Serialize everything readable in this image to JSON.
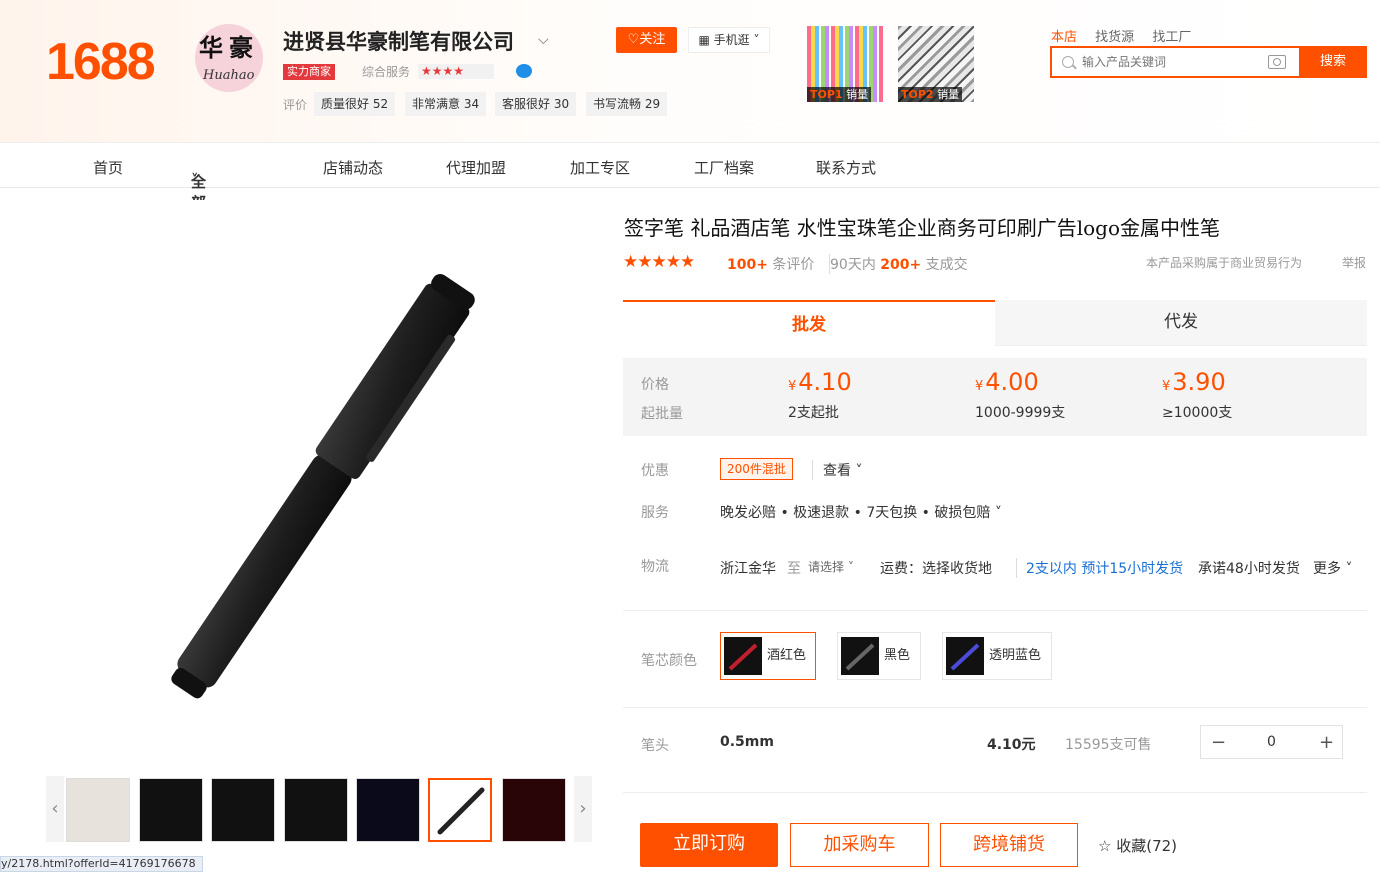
{
  "header": {
    "logo": "1688",
    "shop_name": "进贤县华豪制笔有限公司",
    "avatar_text": {
      "top_left": "华",
      "top_right": "豪",
      "script": "Huahao"
    },
    "power_badge": "实力商家",
    "service_label": "综合服务",
    "service_stars": "★★★★",
    "ratings_label": "评价",
    "ratings": [
      {
        "label": "质量很好",
        "count": "52"
      },
      {
        "label": "非常满意",
        "count": "34"
      },
      {
        "label": "客服很好",
        "count": "30"
      },
      {
        "label": "书写流畅",
        "count": "29"
      }
    ],
    "follow_button": "关注",
    "mobile_button": "手机逛",
    "top_products": [
      {
        "rank": "TOP1",
        "suffix": " 销量"
      },
      {
        "rank": "TOP2",
        "suffix": " 销量"
      }
    ],
    "search_tabs": [
      "本店",
      "找货源",
      "找工厂"
    ],
    "search_placeholder": "输入产品关键词",
    "search_button": "搜索"
  },
  "nav": {
    "items": [
      "首页",
      "全部商品",
      "店铺动态",
      "代理加盟",
      "加工专区",
      "工厂档案",
      "联系方式"
    ]
  },
  "product": {
    "title": "签字笔 礼品酒店笔 水性宝珠笔企业商务可印刷广告logo金属中性笔",
    "stars": "★★★★★",
    "review_count": "100+",
    "review_suffix": " 条评价",
    "sales_prefix": "90天内 ",
    "sales_count": "200+",
    "sales_suffix": " 支成交",
    "notice": "本产品采购属于商业贸易行为",
    "report": "举报",
    "tabs": {
      "wholesale": "批发",
      "dropship": "代发"
    },
    "price_label": "价格",
    "moq_label": "起批量",
    "tiers": [
      {
        "currency": "¥",
        "price": "4.10",
        "qty": "2支起批"
      },
      {
        "currency": "¥",
        "price": "4.00",
        "qty": "1000-9999支"
      },
      {
        "currency": "¥",
        "price": "3.90",
        "qty": "≥10000支"
      }
    ],
    "promo_label": "优惠",
    "promo_tag": "200件混批",
    "promo_view": "查看",
    "service_label": "服务",
    "service_text": "晚发必赔 • 极速退款 • 7天包换 • 破损包赔",
    "logistics_label": "物流",
    "logistics": {
      "origin": "浙江金华",
      "to": "至",
      "dest_select": "请选择",
      "fee": "运费：选择收货地",
      "ship_time": "2支以内 预计15小时发货",
      "promise": "承诺48小时发货",
      "more": "更多"
    },
    "color_label": "笔芯颜色",
    "colors": [
      "酒红色",
      "黑色",
      "透明蓝色"
    ],
    "tip_label": "笔头",
    "tip_value": "0.5mm",
    "tip_price": "4.10元",
    "stock": "15595支可售",
    "quantity": "0",
    "buttons": {
      "buy": "立即订购",
      "cart": "加采购车",
      "cross": "跨境铺货"
    },
    "favorite": "收藏(72)"
  },
  "status_url": "y/2178.html?offerId=41769176678",
  "colors": {
    "accent": "#ff5000"
  }
}
